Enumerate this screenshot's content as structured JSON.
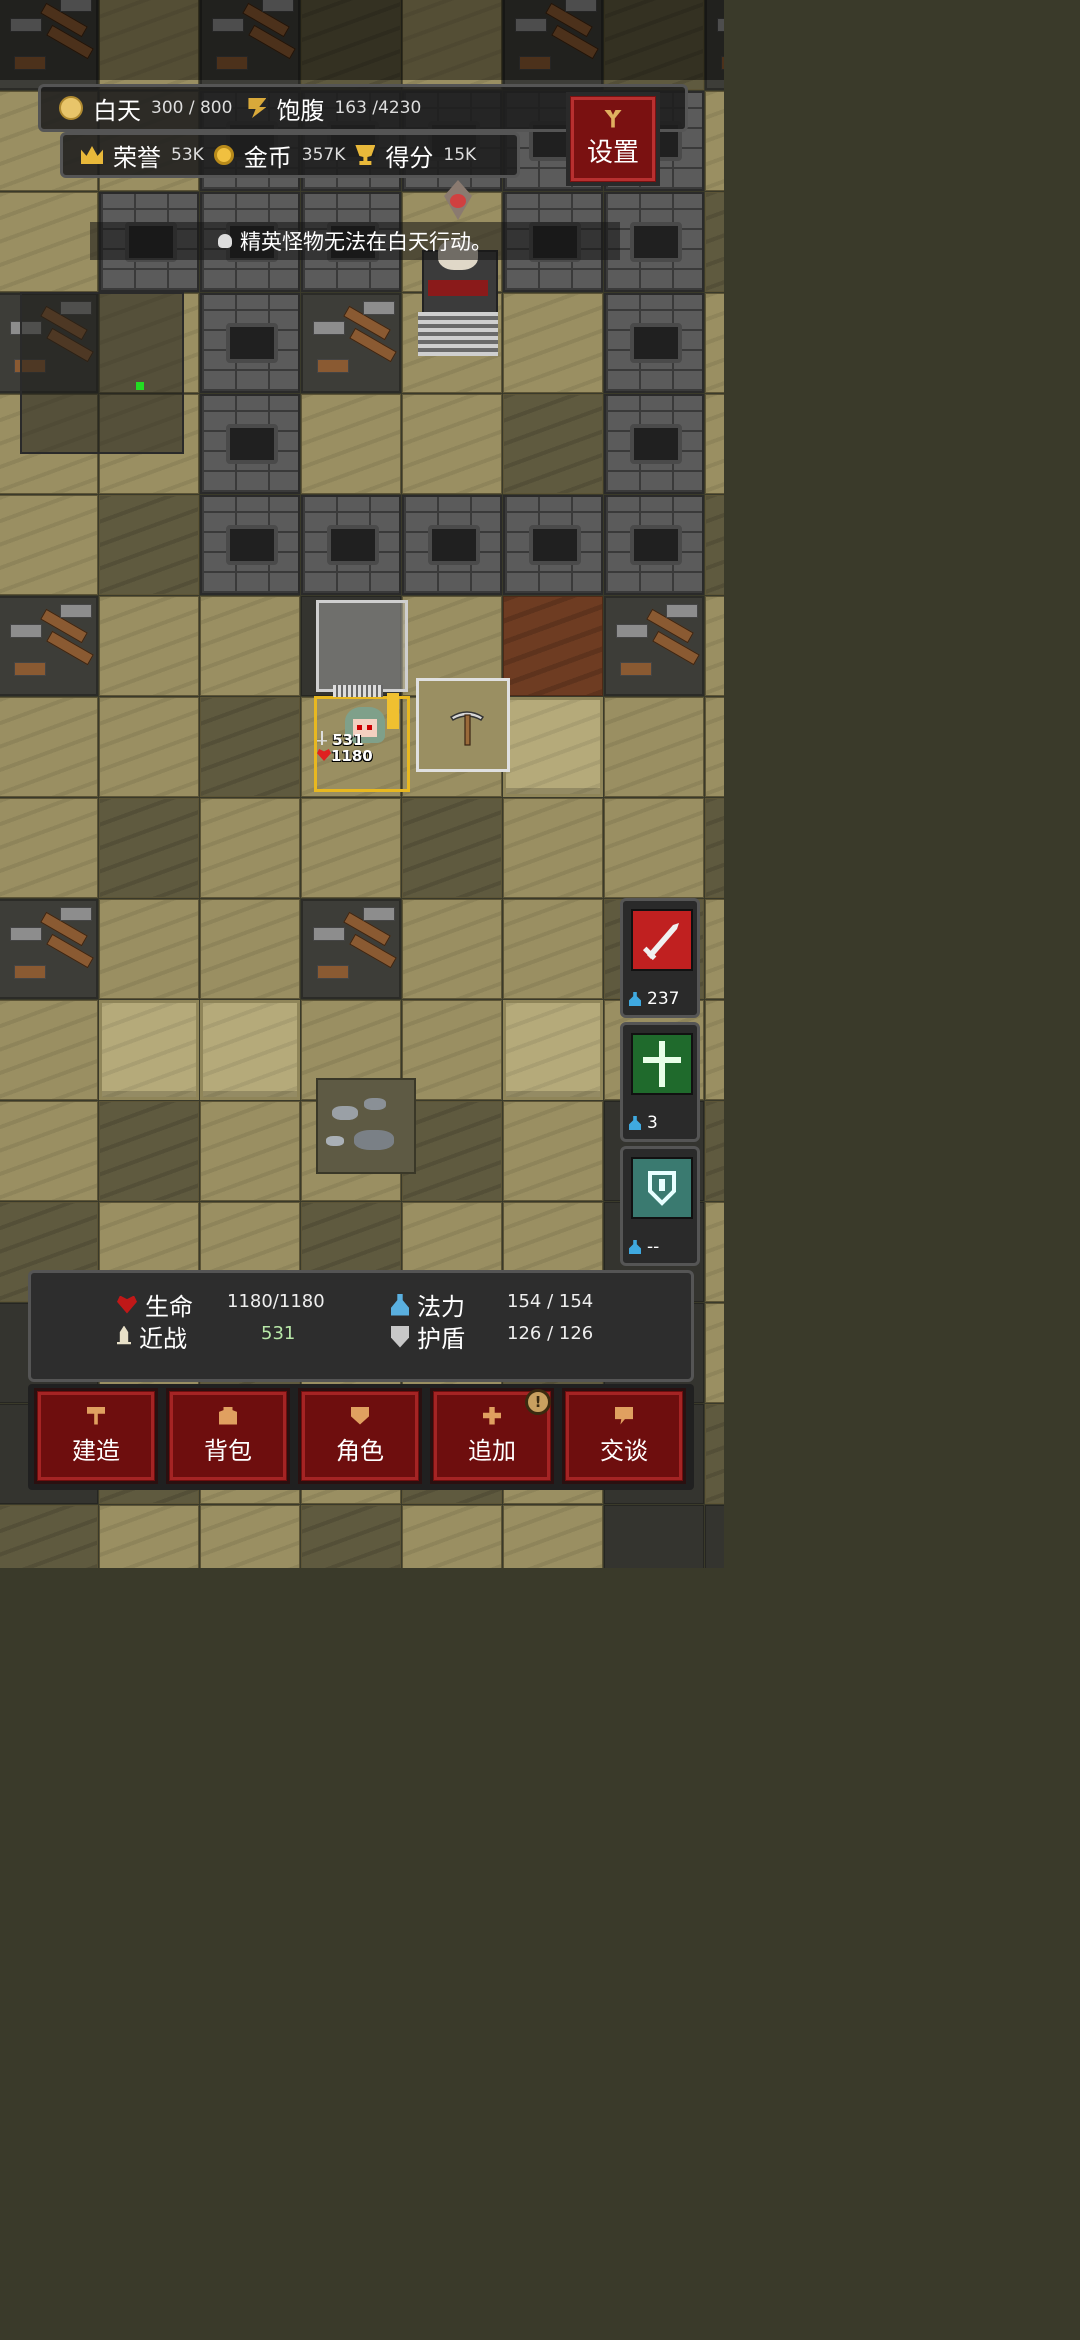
{
  "hud": {
    "day_label": "白天",
    "day_value": "300 / 800",
    "hunger_label": "饱腹",
    "hunger_value": "163 /4230",
    "honor_label": "荣誉",
    "honor_value": "53K",
    "gold_label": "金币",
    "gold_value": "357K",
    "score_label": "得分",
    "score_value": "15K",
    "settings_label": "设置"
  },
  "notice": "精英怪物无法在白天行动。",
  "hero": {
    "attack": "531",
    "hp": "1180"
  },
  "skills": [
    {
      "name": "blade-skill",
      "cost": "237",
      "color": "#c02020"
    },
    {
      "name": "holy-cross-skill",
      "cost": "3",
      "color": "#1f6a2c"
    },
    {
      "name": "shield-skill",
      "cost": "--",
      "color": "#3a7a70"
    }
  ],
  "stats": {
    "hp_label": "生命",
    "hp_value": "1180/1180",
    "mana_label": "法力",
    "mana_value": "154 / 154",
    "melee_label": "近战",
    "melee_value": "531",
    "shield_label": "护盾",
    "shield_value": "126 / 126"
  },
  "menu": {
    "build": "建造",
    "bag": "背包",
    "character": "角色",
    "add": "追加",
    "talk": "交谈",
    "add_badge": "!"
  }
}
